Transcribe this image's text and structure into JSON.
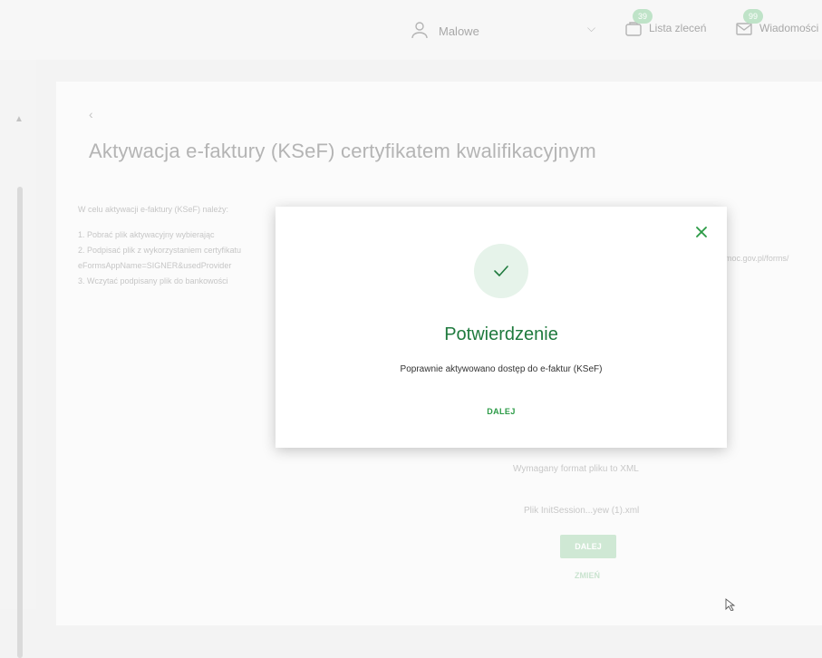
{
  "header": {
    "user_name": "Malowe",
    "orders": {
      "label": "Lista zleceń",
      "badge": "39"
    },
    "messages": {
      "label": "Wiadomości",
      "badge": "99"
    }
  },
  "page": {
    "title": "Aktywacja e-faktury (KSeF) certyfikatem kwalifikacyjnym",
    "intro": "W celu aktywacji e-faktury (KSeF) należy:",
    "steps": [
      "1. Pobrać plik aktywacyjny wybierając",
      "2. Podpisać plik z wykorzystaniem certyfikatu",
      "     eFormsAppName=SIGNER&usedProvider",
      "3. Wczytać podpisany plik do bankowości"
    ],
    "url_fragment": "moc.gov.pl/forms/",
    "format_info": "Wymagany format pliku to XML",
    "file_name": "Plik InitSession...yew (1).xml",
    "next_label": "DALEJ",
    "change_label": "ZMIEŃ"
  },
  "modal": {
    "title": "Potwierdzenie",
    "message": "Poprawnie aktywowano dostęp do e-faktur (KSeF)",
    "action_label": "DALEJ"
  },
  "colors": {
    "accent": "#1f7a3e",
    "success_bg": "#e6f3ea",
    "action": "#2a9a45"
  }
}
